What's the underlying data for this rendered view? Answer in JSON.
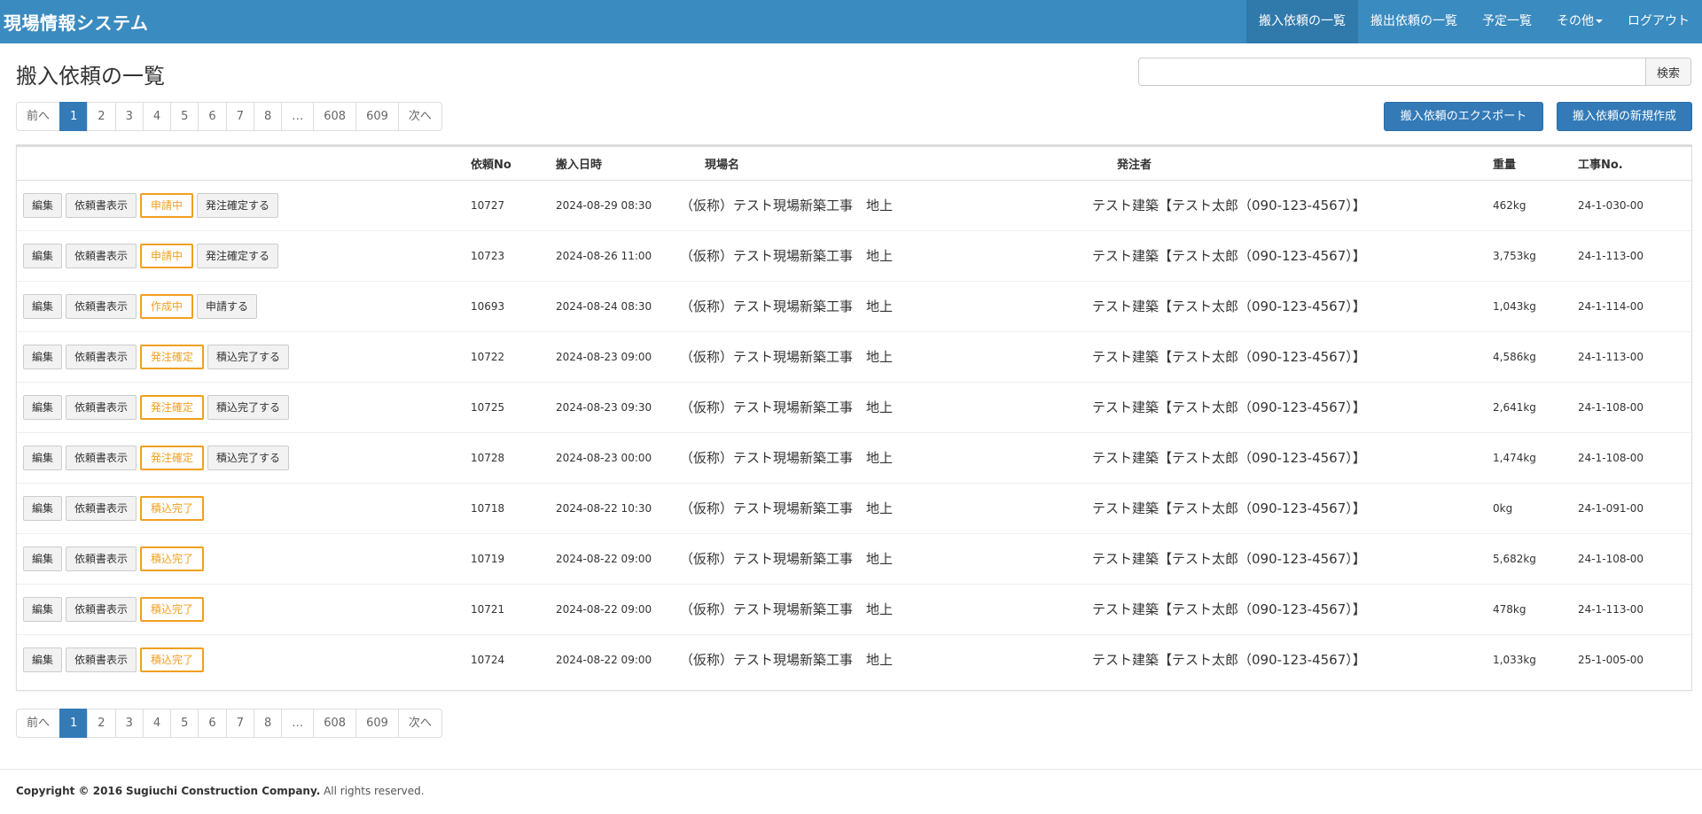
{
  "navbar": {
    "brand": "現場情報システム",
    "items": [
      {
        "label": "搬入依頼の一覧",
        "active": true
      },
      {
        "label": "搬出依頼の一覧",
        "active": false
      },
      {
        "label": "予定一覧",
        "active": false
      },
      {
        "label": "その他",
        "active": false,
        "dropdown": true
      },
      {
        "label": "ログアウト",
        "active": false
      }
    ]
  },
  "page": {
    "title": "搬入依頼の一覧"
  },
  "search": {
    "value": "",
    "placeholder": "",
    "button_label": "検索"
  },
  "actions": {
    "export_label": "搬入依頼のエクスポート",
    "new_label": "搬入依頼の新規作成"
  },
  "pagination": {
    "prev": "前へ",
    "next": "次へ",
    "pages": [
      "1",
      "2",
      "3",
      "4",
      "5",
      "6",
      "7",
      "8",
      "…",
      "608",
      "609"
    ],
    "current": "1"
  },
  "table": {
    "headers": {
      "actions": "",
      "request_no": "依頼No",
      "datetime": "搬入日時",
      "site": "現場名",
      "orderer": "発注者",
      "weight": "重量",
      "work_no": "工事No."
    },
    "button_labels": {
      "edit": "編集",
      "view": "依頼書表示"
    },
    "rows": [
      {
        "status": "申請中",
        "action": "発注確定する",
        "no": "10727",
        "datetime": "2024-08-29 08:30",
        "site": "（仮称）テスト現場新築工事　地上",
        "orderer": "テスト建築【テスト太郎（090-123-4567）】",
        "weight": "462kg",
        "work_no": "24-1-030-00"
      },
      {
        "status": "申請中",
        "action": "発注確定する",
        "no": "10723",
        "datetime": "2024-08-26 11:00",
        "site": "（仮称）テスト現場新築工事　地上",
        "orderer": "テスト建築【テスト太郎（090-123-4567）】",
        "weight": "3,753kg",
        "work_no": "24-1-113-00"
      },
      {
        "status": "作成中",
        "action": "申請する",
        "no": "10693",
        "datetime": "2024-08-24 08:30",
        "site": "（仮称）テスト現場新築工事　地上",
        "orderer": "テスト建築【テスト太郎（090-123-4567）】",
        "weight": "1,043kg",
        "work_no": "24-1-114-00"
      },
      {
        "status": "発注確定",
        "action": "積込完了する",
        "no": "10722",
        "datetime": "2024-08-23 09:00",
        "site": "（仮称）テスト現場新築工事　地上",
        "orderer": "テスト建築【テスト太郎（090-123-4567）】",
        "weight": "4,586kg",
        "work_no": "24-1-113-00"
      },
      {
        "status": "発注確定",
        "action": "積込完了する",
        "no": "10725",
        "datetime": "2024-08-23 09:30",
        "site": "（仮称）テスト現場新築工事　地上",
        "orderer": "テスト建築【テスト太郎（090-123-4567）】",
        "weight": "2,641kg",
        "work_no": "24-1-108-00"
      },
      {
        "status": "発注確定",
        "action": "積込完了する",
        "no": "10728",
        "datetime": "2024-08-23 00:00",
        "site": "（仮称）テスト現場新築工事　地上",
        "orderer": "テスト建築【テスト太郎（090-123-4567）】",
        "weight": "1,474kg",
        "work_no": "24-1-108-00"
      },
      {
        "status": "積込完了",
        "action": "",
        "no": "10718",
        "datetime": "2024-08-22 10:30",
        "site": "（仮称）テスト現場新築工事　地上",
        "orderer": "テスト建築【テスト太郎（090-123-4567）】",
        "weight": "0kg",
        "work_no": "24-1-091-00"
      },
      {
        "status": "積込完了",
        "action": "",
        "no": "10719",
        "datetime": "2024-08-22 09:00",
        "site": "（仮称）テスト現場新築工事　地上",
        "orderer": "テスト建築【テスト太郎（090-123-4567）】",
        "weight": "5,682kg",
        "work_no": "24-1-108-00"
      },
      {
        "status": "積込完了",
        "action": "",
        "no": "10721",
        "datetime": "2024-08-22 09:00",
        "site": "（仮称）テスト現場新築工事　地上",
        "orderer": "テスト建築【テスト太郎（090-123-4567）】",
        "weight": "478kg",
        "work_no": "24-1-113-00"
      },
      {
        "status": "積込完了",
        "action": "",
        "no": "10724",
        "datetime": "2024-08-22 09:00",
        "site": "（仮称）テスト現場新築工事　地上",
        "orderer": "テスト建築【テスト太郎（090-123-4567）】",
        "weight": "1,033kg",
        "work_no": "25-1-005-00"
      }
    ]
  },
  "footer": {
    "copyright": "Copyright © 2016",
    "company": "Sugiuchi Construction Company.",
    "rights": "All rights reserved."
  },
  "colors": {
    "navbar": "#3a8bbf",
    "primary": "#337ab7",
    "status_border": "#f0a020"
  }
}
